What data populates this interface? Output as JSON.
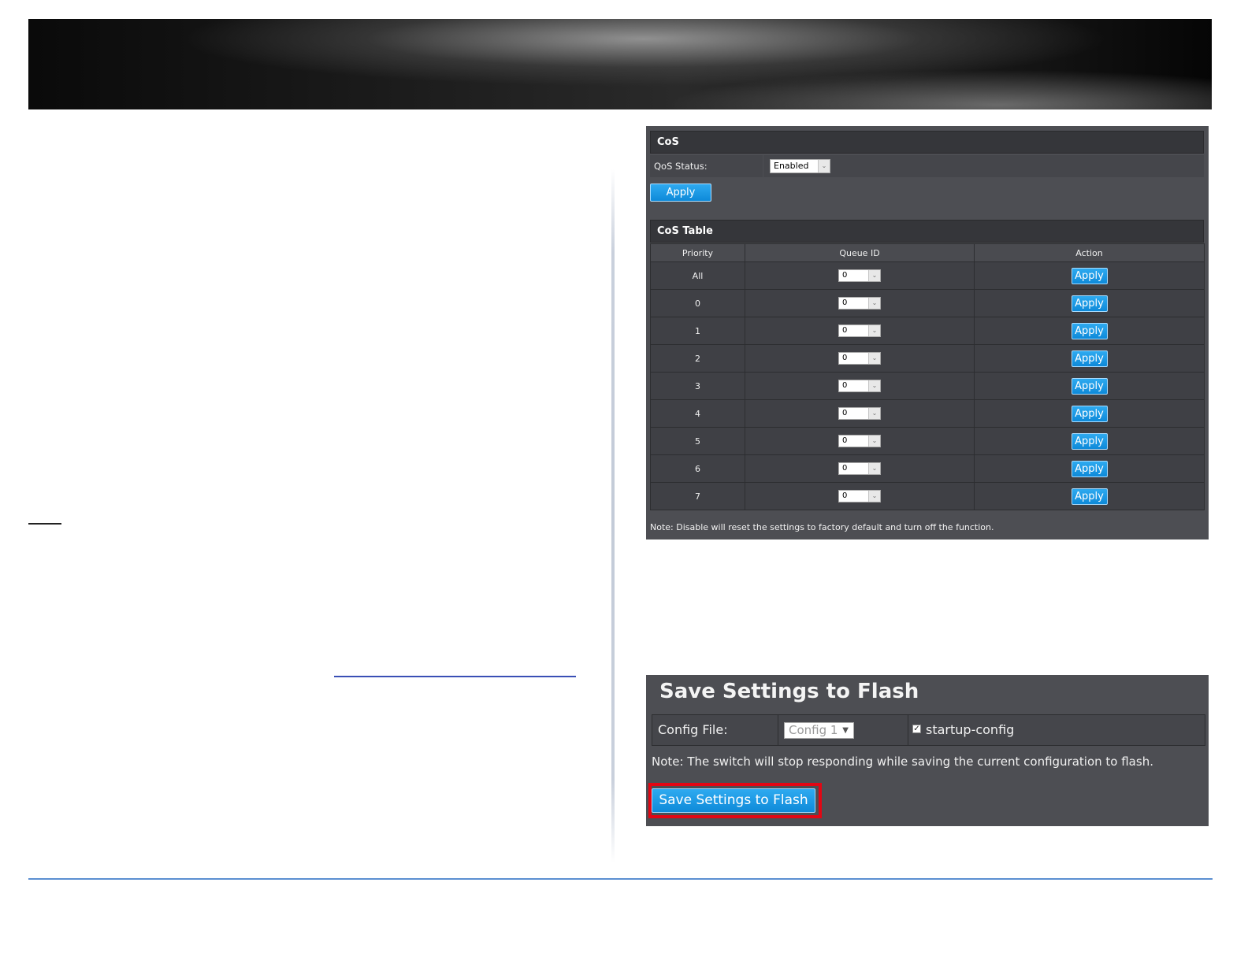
{
  "cos": {
    "section_title": "CoS",
    "qos_status_label": "QoS Status:",
    "qos_status_value": "Enabled",
    "apply_label": "Apply",
    "table_title": "CoS Table",
    "columns": [
      "Priority",
      "Queue ID",
      "Action"
    ],
    "rows": [
      {
        "priority": "All",
        "queue_id": "0",
        "action": "Apply"
      },
      {
        "priority": "0",
        "queue_id": "0",
        "action": "Apply"
      },
      {
        "priority": "1",
        "queue_id": "0",
        "action": "Apply"
      },
      {
        "priority": "2",
        "queue_id": "0",
        "action": "Apply"
      },
      {
        "priority": "3",
        "queue_id": "0",
        "action": "Apply"
      },
      {
        "priority": "4",
        "queue_id": "0",
        "action": "Apply"
      },
      {
        "priority": "5",
        "queue_id": "0",
        "action": "Apply"
      },
      {
        "priority": "6",
        "queue_id": "0",
        "action": "Apply"
      },
      {
        "priority": "7",
        "queue_id": "0",
        "action": "Apply"
      }
    ],
    "note": "Note: Disable will reset the settings to factory default and turn off the function."
  },
  "save": {
    "title": "Save Settings to Flash",
    "config_file_label": "Config File:",
    "config_file_value": "Config 1",
    "startup_config_label": "startup-config",
    "startup_config_checked": true,
    "note": "Note: The switch will stop responding while saving the current configuration to flash.",
    "button_label": "Save Settings to Flash"
  },
  "colors": {
    "panel_bg": "#4d4e53",
    "button_blue": "#1a9be6",
    "highlight_red": "#e30613",
    "link_blue": "#3a4fb5",
    "footer_rule": "#5b8fd1"
  }
}
